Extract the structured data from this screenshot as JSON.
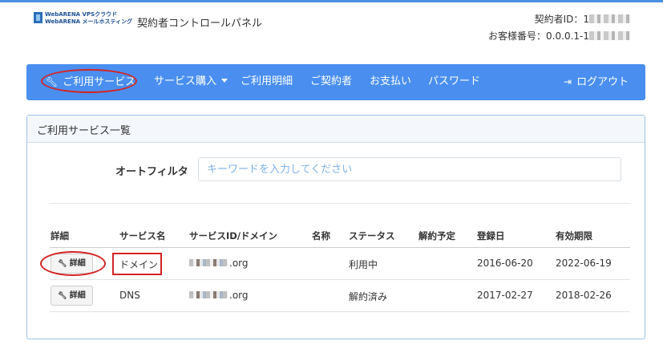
{
  "colors": {
    "navbar": "#4a8ff0",
    "highlight": "#d42424",
    "panel_border": "#9ec0ee"
  },
  "header": {
    "logo_line1": "WebARENA VPSクラウド",
    "logo_line2": "WebARENA メールホスティング",
    "app_title": "契約者コントロールパネル",
    "contract_id_label": "契約者ID：1",
    "customer_no_label": "お客様番号：0.0.0.1-1"
  },
  "nav": {
    "items": [
      {
        "label": "ご利用サービス",
        "icon": "wrench-icon"
      },
      {
        "label": "サービス購入",
        "icon": "caret-down-icon"
      },
      {
        "label": "ご利用明細"
      },
      {
        "label": "ご契約者"
      },
      {
        "label": "お支払い"
      },
      {
        "label": "パスワード"
      }
    ],
    "logout": {
      "label": "ログアウト",
      "icon": "logout-icon"
    }
  },
  "panel": {
    "title": "ご利用サービス一覧",
    "filter_label": "オートフィルタ",
    "filter_placeholder": "キーワードを入力してください",
    "filter_value": ""
  },
  "table": {
    "headers": [
      "詳細",
      "サービス名",
      "サービスID/ドメイン",
      "名称",
      "ステータス",
      "解約予定",
      "登録日",
      "有効期限"
    ],
    "detail_button_label": "詳細",
    "rows": [
      {
        "service_name": "ドメイン",
        "domain_suffix": ".org",
        "name": "",
        "status": "利用中",
        "cancel_date": "",
        "registered": "2016-06-20",
        "expires": "2022-06-19"
      },
      {
        "service_name": "DNS",
        "domain_suffix": ".org",
        "name": "",
        "status": "解約済み",
        "cancel_date": "",
        "registered": "2017-02-27",
        "expires": "2018-02-26"
      }
    ]
  }
}
